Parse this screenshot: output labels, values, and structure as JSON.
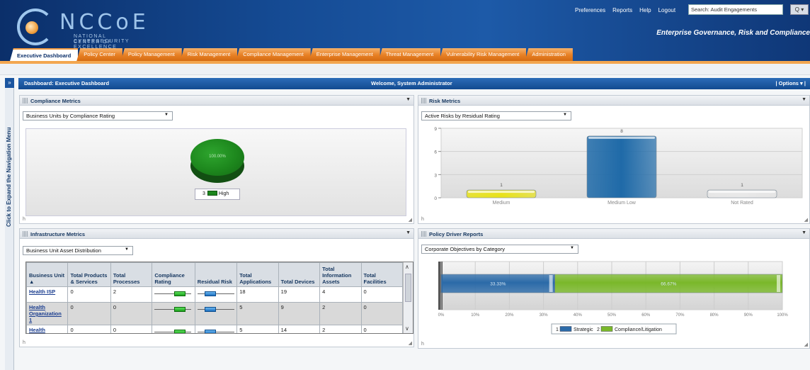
{
  "header": {
    "logo_main": "NCCoE",
    "logo_sub1": "NATIONAL CYBERSECURITY",
    "logo_sub2": "CENTER OF EXCELLENCE",
    "links": [
      "Preferences",
      "Reports",
      "Help",
      "Logout"
    ],
    "search_value": "Search: Audit Engagements",
    "search_button": "Q ▾",
    "tagline": "Enterprise Governance, Risk and Compliance"
  },
  "tabs": [
    {
      "label": "Executive Dashboard",
      "active": true
    },
    {
      "label": "Policy Center"
    },
    {
      "label": "Policy Management"
    },
    {
      "label": "Risk Management"
    },
    {
      "label": "Compliance Management"
    },
    {
      "label": "Enterprise Management"
    },
    {
      "label": "Threat Management"
    },
    {
      "label": "Vulnerability Risk Management"
    },
    {
      "label": "Administration"
    }
  ],
  "leftnav": {
    "button": "»",
    "label": "Click to Expand the Navigation Menu"
  },
  "dashboard": {
    "title": "Dashboard: Executive Dashboard",
    "welcome": "Welcome, System Administrator",
    "options": "| Options ▾ |"
  },
  "compliance": {
    "title": "Compliance Metrics",
    "select": "Business Units by Compliance Rating",
    "pie_label": "100.00%",
    "legend_count": "3",
    "legend_label": "High",
    "color": "#1d871d"
  },
  "risk": {
    "title": "Risk Metrics",
    "select": "Active Risks by Residual Rating"
  },
  "infrastructure": {
    "title": "Infrastructure Metrics",
    "select": "Business Unit Asset Distribution",
    "columns": [
      "Business Unit ▲",
      "Total Products & Services",
      "Total Processes",
      "Compliance Rating",
      "Residual Risk",
      "Total Applications",
      "Total Devices",
      "Total Information Assets",
      "Total Facilities"
    ],
    "rows": [
      {
        "unit": "Health ISP",
        "products": "0",
        "processes": "2",
        "compliance_level": 0.7,
        "risk_level": 0.35,
        "applications": "18",
        "devices": "19",
        "info_assets": "4",
        "facilities": "0"
      },
      {
        "unit": "Health Organization 1",
        "products": "0",
        "processes": "0",
        "compliance_level": 0.7,
        "risk_level": 0.35,
        "applications": "5",
        "devices": "9",
        "info_assets": "2",
        "facilities": "0"
      },
      {
        "unit": "Health Organization",
        "products": "0",
        "processes": "0",
        "compliance_level": 0.7,
        "risk_level": 0.35,
        "applications": "5",
        "devices": "14",
        "info_assets": "2",
        "facilities": "0"
      }
    ]
  },
  "policy": {
    "title": "Policy Driver Reports",
    "select": "Corporate Objectives by Category"
  },
  "chart_data": [
    {
      "id": "risk",
      "type": "bar",
      "title": "",
      "categories": [
        "Medium",
        "Medium Low",
        "Not Rated"
      ],
      "values": [
        1,
        8,
        1
      ],
      "colors": [
        "#e8e21a",
        "#1f6aa8",
        "#e8e8e8"
      ],
      "ylim": [
        0,
        9
      ],
      "yticks": [
        0,
        3,
        6,
        9
      ],
      "grid": true
    },
    {
      "id": "compliance",
      "type": "pie",
      "categories": [
        "High"
      ],
      "values": [
        3
      ],
      "percent_labels": [
        "100.00%"
      ],
      "colors": [
        "#1d871d"
      ]
    },
    {
      "id": "policy",
      "type": "bar",
      "orientation": "horizontal-stacked",
      "series": [
        {
          "name": "Strategic",
          "count": 1,
          "value": 33.33,
          "label": "33.33%",
          "color": "#2b6aa8"
        },
        {
          "name": "Compliance/Litigation",
          "count": 2,
          "value": 66.67,
          "label": "66.67%",
          "color": "#7ab82a"
        }
      ],
      "xlim": [
        0,
        100
      ],
      "xticks": [
        "0%",
        "10%",
        "20%",
        "30%",
        "40%",
        "50%",
        "60%",
        "70%",
        "80%",
        "90%",
        "100%"
      ],
      "legend": "bottom"
    }
  ]
}
